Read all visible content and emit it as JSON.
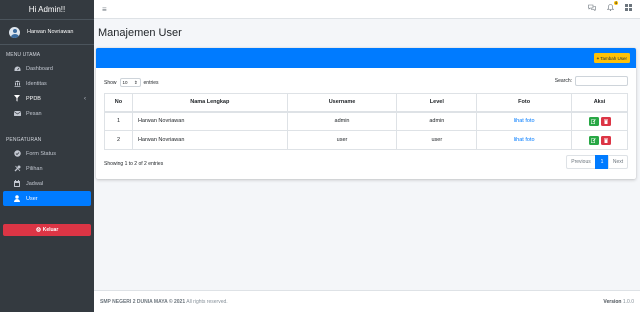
{
  "sidebar": {
    "brand": "Hi Admin!!",
    "user_name": "Harwan Novriawan",
    "header_main": "MENU UTAMA",
    "header_settings": "PENGATURAN",
    "items_main": [
      {
        "label": "Dashboard",
        "icon": "dashboard-icon"
      },
      {
        "label": "Identitas",
        "icon": "institution-icon"
      },
      {
        "label": "PPDB",
        "icon": "filter-icon"
      },
      {
        "label": "Pesan",
        "icon": "envelope-icon"
      }
    ],
    "items_settings": [
      {
        "label": "Form Status",
        "icon": "check-circle-icon"
      },
      {
        "label": "Pilihan",
        "icon": "tools-icon"
      },
      {
        "label": "Jadwal",
        "icon": "calendar-icon"
      },
      {
        "label": "User",
        "icon": "user-icon"
      }
    ],
    "logout_label": "Keluar"
  },
  "topbar": {
    "notification_count": "4"
  },
  "page": {
    "title": "Manajemen User",
    "add_button": "Tambah User"
  },
  "table": {
    "show_label": "Show",
    "page_length": "10",
    "entries_label": "entries",
    "search_label": "Search:",
    "columns": [
      "No",
      "Nama Lengkap",
      "Username",
      "Level",
      "Foto",
      "Aksi"
    ],
    "rows": [
      {
        "no": "1",
        "name": "Harwan Novriawan",
        "username": "admin",
        "level": "admin",
        "foto": "lihat foto"
      },
      {
        "no": "2",
        "name": "Harwan Novriawan",
        "username": "user",
        "level": "user",
        "foto": "lihat foto"
      }
    ],
    "info": "Showing 1 to 2 of 2 entries",
    "pager": {
      "prev": "Previous",
      "current": "1",
      "next": "Next"
    }
  },
  "footer": {
    "copyright": "SMP NEGERI 2 DUNIA MAYA © 2021",
    "rights": "All rights reserved.",
    "version_label": "Version",
    "version": "1.0.0"
  },
  "colors": {
    "primary": "#007bff",
    "sidebar": "#343a40",
    "danger": "#dc3545",
    "warning": "#ffc107",
    "success": "#28a745"
  }
}
